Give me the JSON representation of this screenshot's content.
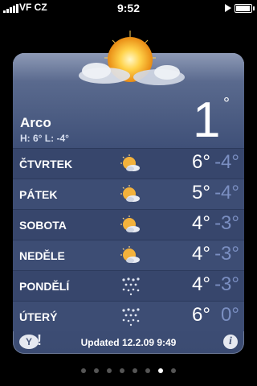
{
  "status_bar": {
    "carrier": "VF CZ",
    "time": "9:52"
  },
  "weather": {
    "city": "Arco",
    "high_low": "H: 6° L: -4°",
    "current_temp": "1",
    "current_degree": "°",
    "forecast": [
      {
        "day": "ČTVRTEK",
        "high": "6°",
        "low": "-4°",
        "icon": "sun-cloud-icon"
      },
      {
        "day": "PÁTEK",
        "high": "5°",
        "low": "-4°",
        "icon": "sun-cloud-icon"
      },
      {
        "day": "SOBOTA",
        "high": "4°",
        "low": "-3°",
        "icon": "sun-cloud-icon"
      },
      {
        "day": "NEDĚLE",
        "high": "4°",
        "low": "-3°",
        "icon": "sun-cloud-icon"
      },
      {
        "day": "PONDĚLÍ",
        "high": "4°",
        "low": "-3°",
        "icon": "snow-icon"
      },
      {
        "day": "ÚTERÝ",
        "high": "6°",
        "low": "0°",
        "icon": "snow-icon"
      }
    ],
    "updated": "Updated 12.2.09 9:49"
  },
  "page_indicator": {
    "count": 8,
    "active_index": 6
  },
  "colors": {
    "low_temp": "#7b8fc2",
    "card": "#3b4b72"
  }
}
